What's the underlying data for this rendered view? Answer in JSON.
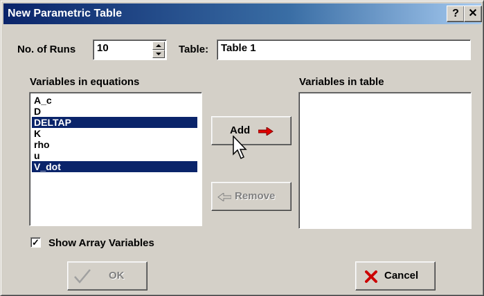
{
  "window": {
    "title": "New Parametric Table",
    "help_label": "?",
    "close_label": "✕"
  },
  "runs": {
    "label": "No. of Runs",
    "value": "10"
  },
  "table": {
    "label": "Table:",
    "value": "Table 1"
  },
  "equations": {
    "label": "Variables in equations",
    "items": [
      {
        "label": "A_c",
        "selected": false
      },
      {
        "label": "D",
        "selected": false
      },
      {
        "label": "DELTAP",
        "selected": true
      },
      {
        "label": "K",
        "selected": false
      },
      {
        "label": "rho",
        "selected": false
      },
      {
        "label": "u",
        "selected": false
      },
      {
        "label": "V_dot",
        "selected": true
      }
    ]
  },
  "table_vars": {
    "label": "Variables in table",
    "items": []
  },
  "buttons": {
    "add": "Add",
    "remove": "Remove",
    "ok": "OK",
    "cancel": "Cancel"
  },
  "show_array": {
    "label": "Show Array Variables",
    "checked": true
  },
  "colors": {
    "selection": "#0a246a",
    "arrow": "#e00000",
    "cancel_x": "#cc0000",
    "title_bar": "#0a246a"
  }
}
